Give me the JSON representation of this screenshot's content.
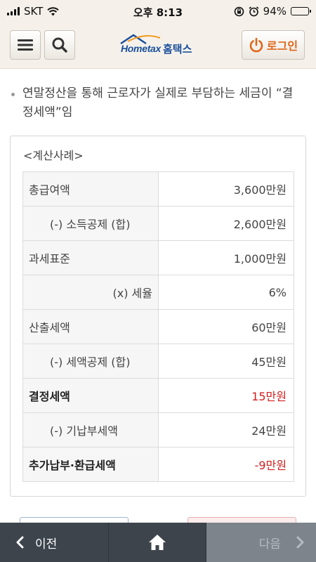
{
  "status_bar": {
    "carrier": "SKT",
    "time": "오후 8:13",
    "battery": "94%"
  },
  "header": {
    "logo_brand": "Hometax",
    "logo_brand_ko": "홈택스",
    "login_label": "로그인",
    "accent_color": "#e0661a"
  },
  "content": {
    "description": "연말정산을 통해 근로자가 실제로 부담하는 세금이 “결정세액”임",
    "example_title": "<계산사례>",
    "rows": [
      {
        "label": "총급여액",
        "value": "3,600만원"
      },
      {
        "label": "(-) 소득공제 (합)",
        "value": "2,600만원"
      },
      {
        "label": "과세표준",
        "value": "1,000만원"
      },
      {
        "label": "(x) 세율",
        "value": "6%"
      },
      {
        "label": "산출세액",
        "value": "60만원"
      },
      {
        "label": "(-) 세액공제 (합)",
        "value": "45만원"
      },
      {
        "label": "결정세액",
        "value": "15만원"
      },
      {
        "label": "(-) 기납부세액",
        "value": "24만원"
      },
      {
        "label": "추가납부·환급세액",
        "value": "-9만원"
      }
    ]
  },
  "footer": {
    "prev_label": "이전",
    "next_label": "다음"
  }
}
